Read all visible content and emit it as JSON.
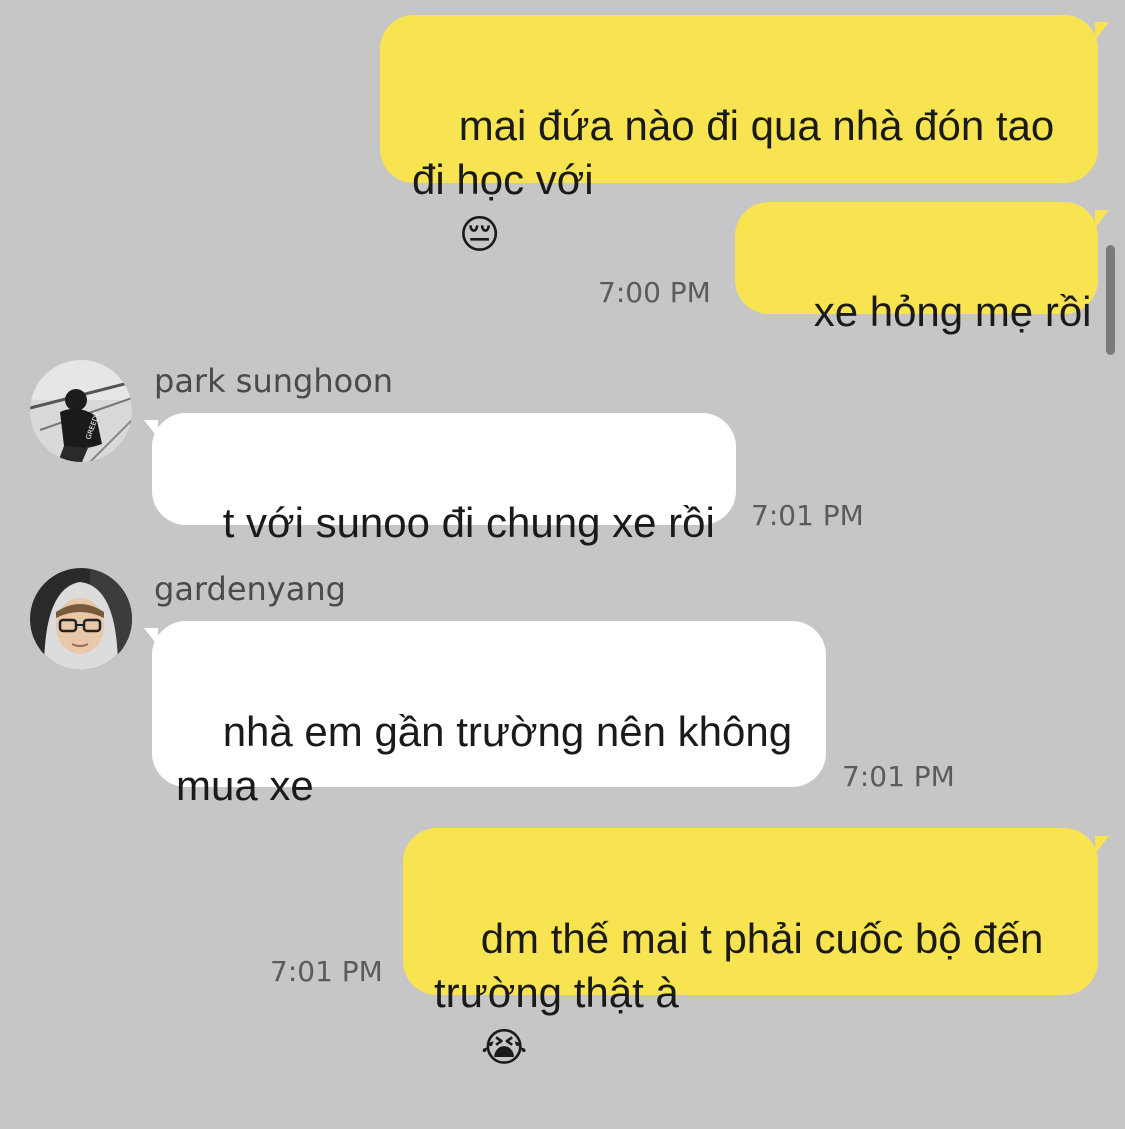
{
  "messages": [
    {
      "direction": "outgoing",
      "text": "mai đứa nào đi qua nhà đón tao\nđi học với",
      "emoji": "😔",
      "time": ""
    },
    {
      "direction": "outgoing",
      "text": "xe hỏng mẹ rồi",
      "time": "7:00 PM"
    },
    {
      "direction": "incoming",
      "sender": "park sunghoon",
      "avatar_caption": "GREEDY",
      "text": "t với sunoo đi chung xe rồi",
      "time": "7:01 PM"
    },
    {
      "direction": "incoming",
      "sender": "gardenyang",
      "text": "nhà em gần trường nên không\nmua xe",
      "time": "7:01 PM"
    },
    {
      "direction": "outgoing",
      "text": "dm thế mai t phải cuốc bộ đến\ntrường thật à",
      "emoji": "😭",
      "time": "7:01 PM"
    }
  ],
  "colors": {
    "background": "#c6c6c6",
    "outgoing_bubble": "#f8e451",
    "incoming_bubble": "#ffffff",
    "timestamp": "#5b5b5b"
  }
}
